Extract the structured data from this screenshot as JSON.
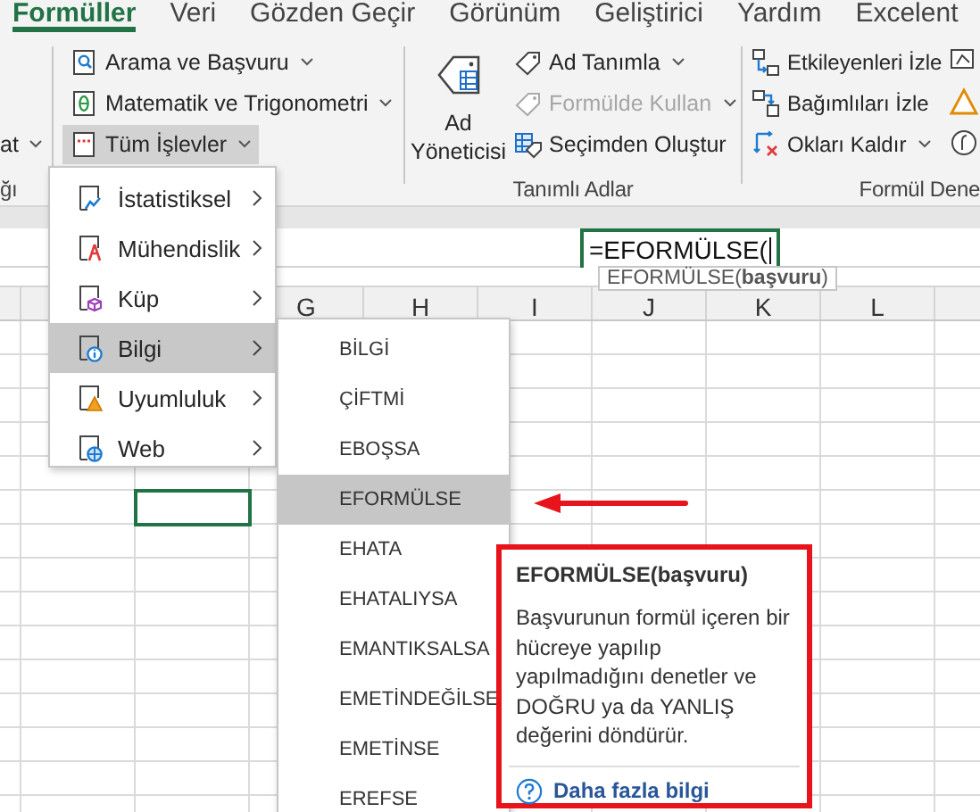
{
  "tabs": [
    {
      "label": "Formüller",
      "selected": true
    },
    {
      "label": "Veri",
      "selected": false
    },
    {
      "label": "Gözden Geçir",
      "selected": false
    },
    {
      "label": "Görünüm",
      "selected": false
    },
    {
      "label": "Geliştirici",
      "selected": false
    },
    {
      "label": "Yardım",
      "selected": false
    },
    {
      "label": "Excelent",
      "selected": false
    }
  ],
  "ribbon": {
    "groups": [
      {
        "label": "ğı",
        "buttons": [
          {
            "kind": "small",
            "label": "at",
            "dropdown": true,
            "expanded": false,
            "disabled": false
          }
        ]
      },
      {
        "buttons": [
          {
            "kind": "small",
            "label": "Arama ve Başvuru",
            "dropdown": true,
            "expanded": false,
            "disabled": false
          },
          {
            "kind": "small",
            "label": "Matematik ve Trigonometri",
            "dropdown": true,
            "expanded": false,
            "disabled": false
          },
          {
            "kind": "small",
            "label": "Tüm İşlevler",
            "dropdown": true,
            "expanded": true,
            "disabled": false
          }
        ]
      },
      {
        "label": "Tanımlı Adlar",
        "buttons": [
          {
            "kind": "large",
            "label": "Ad Yöneticisi",
            "dropdown": false,
            "expanded": false,
            "disabled": false
          },
          {
            "kind": "small",
            "label": "Ad Tanımla",
            "dropdown": true,
            "expanded": false,
            "disabled": false
          },
          {
            "kind": "small",
            "label": "Formülde Kullan",
            "dropdown": true,
            "expanded": false,
            "disabled": true
          },
          {
            "kind": "small",
            "label": "Seçimden Oluştur",
            "dropdown": false,
            "expanded": false,
            "disabled": false
          }
        ]
      },
      {
        "label": "Formül Dene",
        "buttons": [
          {
            "kind": "small",
            "label": "Etkileyenleri İzle",
            "dropdown": false,
            "expanded": false,
            "disabled": false
          },
          {
            "kind": "small",
            "label": "Bağımlıları İzle",
            "dropdown": false,
            "expanded": false,
            "disabled": false
          },
          {
            "kind": "small",
            "label": "Okları Kaldır",
            "dropdown": true,
            "expanded": false,
            "disabled": false
          }
        ]
      }
    ]
  },
  "formula_bar": {
    "value": "=EFORMÜLSE("
  },
  "formula_hint": "EFORMÜLSE(**başvuru**)",
  "columns": [
    "G",
    "H",
    "I",
    "J",
    "K",
    "L"
  ],
  "function_menu": {
    "items": [
      {
        "label": "İstatistiksel",
        "selected": false
      },
      {
        "label": "Mühendislik",
        "selected": false
      },
      {
        "label": "Küp",
        "selected": false
      },
      {
        "label": "Bilgi",
        "selected": true
      },
      {
        "label": "Uyumluluk",
        "selected": false
      },
      {
        "label": "Web",
        "selected": false
      }
    ]
  },
  "submenu": {
    "items": [
      {
        "label": "BİLGİ",
        "selected": false
      },
      {
        "label": "ÇİFTMİ",
        "selected": false
      },
      {
        "label": "EBOŞSA",
        "selected": false
      },
      {
        "label": "EFORMÜLSE",
        "selected": true
      },
      {
        "label": "EHATA",
        "selected": false
      },
      {
        "label": "EHATALIYSA",
        "selected": false
      },
      {
        "label": "EMANTIKSALSA",
        "selected": false
      },
      {
        "label": "EMETİNDEĞİLSE",
        "selected": false
      },
      {
        "label": "EMETİNSE",
        "selected": false
      },
      {
        "label": "EREFSE",
        "selected": false
      }
    ]
  },
  "tooltip": {
    "title": "EFORMÜLSE(başvuru)",
    "description": "Başvurunun formül içeren bir hücreye yapılıp yapılmadığını denetler ve DOĞRU ya da YANLIŞ değerini döndürür.",
    "link": "Daha fazla bilgi"
  }
}
